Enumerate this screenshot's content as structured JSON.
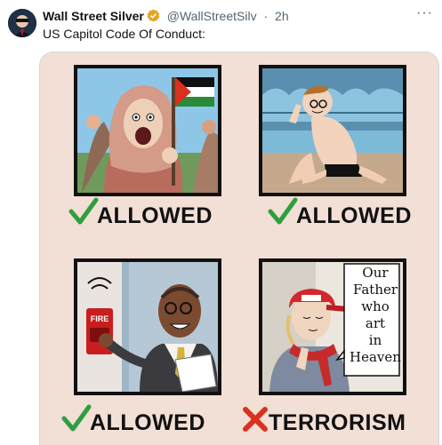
{
  "tweet": {
    "author_name": "Wall Street Silver",
    "handle": "@WallStreetSilv",
    "separator": "·",
    "time": "2h",
    "text": "US Capitol Code Of Conduct:",
    "more_glyph": "···"
  },
  "comic": {
    "labels": [
      "ALLOWED",
      "ALLOWED",
      "ALLOWED",
      "TERRORISM"
    ],
    "fire_alarm_text": "FIRE",
    "speech_lines": [
      "Our",
      "Father",
      "who",
      "art",
      "in",
      "Heaven"
    ]
  },
  "colors": {
    "check": "#2e9e3f",
    "cross": "#d8321e",
    "verified": "#e7a31f",
    "background": "#f2dfd5"
  },
  "icons": [
    "verified-badge-icon",
    "more-options-icon",
    "check-mark-icon",
    "x-mark-icon"
  ]
}
